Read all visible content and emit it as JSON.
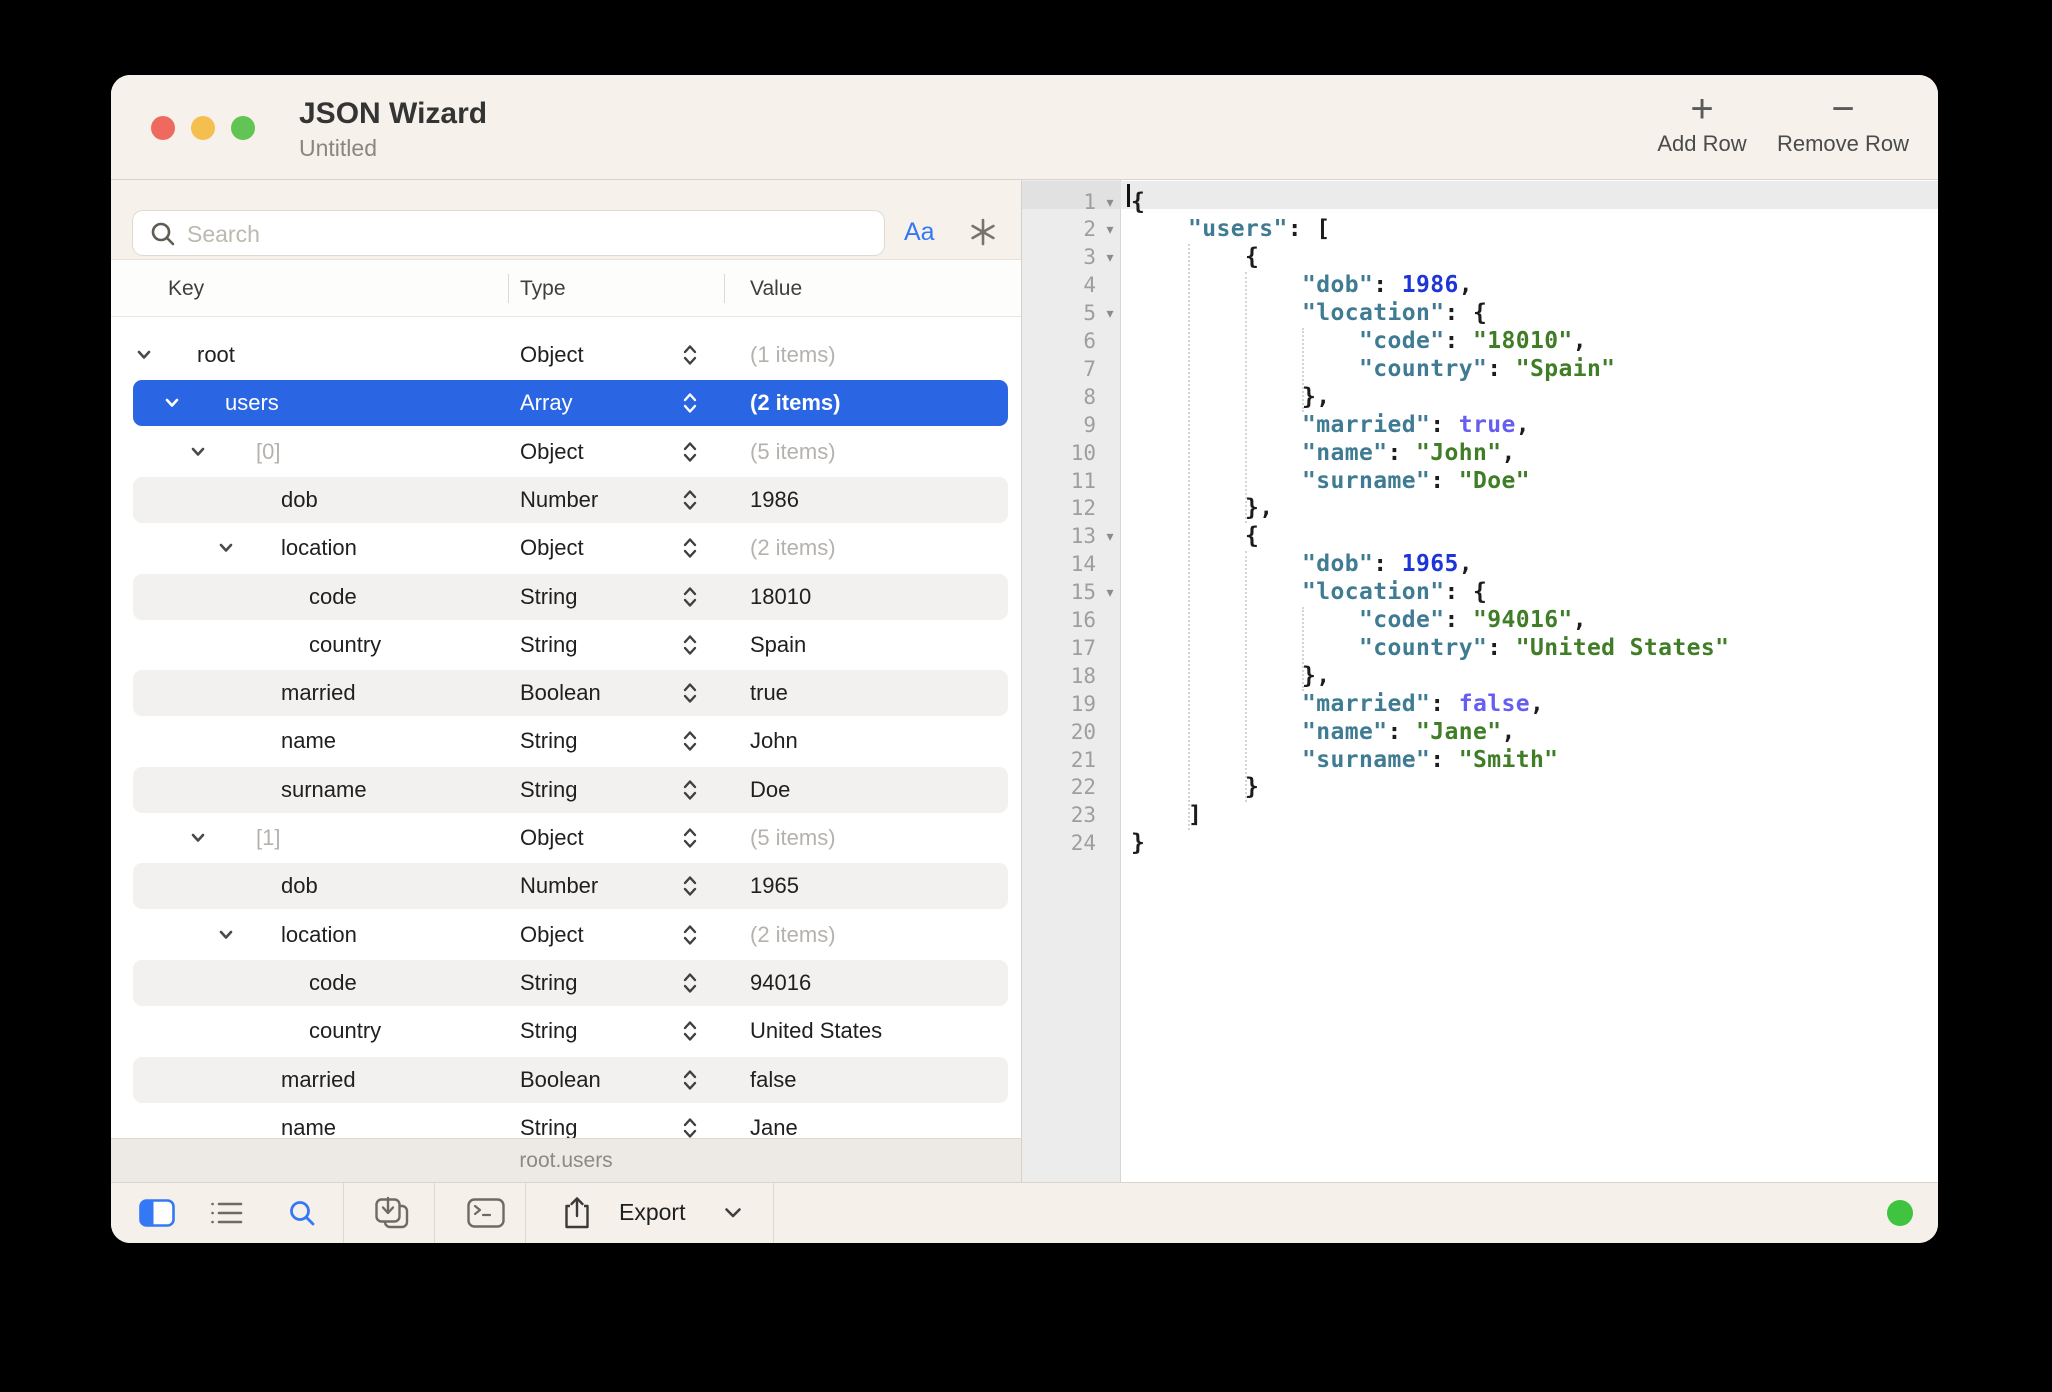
{
  "window": {
    "title": "JSON Wizard",
    "subtitle": "Untitled"
  },
  "actions": {
    "add_row": {
      "glyph": "+",
      "label": "Add Row"
    },
    "remove_row": {
      "glyph": "−",
      "label": "Remove Row"
    }
  },
  "search": {
    "placeholder": "Search",
    "match_case_label": "Aa"
  },
  "table": {
    "columns": [
      "Key",
      "Type",
      "Value"
    ],
    "rows": [
      {
        "key": "root",
        "level": 0,
        "expandable": true,
        "type": "Object",
        "value": "(1 items)",
        "muted_key": false,
        "muted_value": true,
        "selected": false,
        "shaded": false
      },
      {
        "key": "users",
        "level": 1,
        "expandable": true,
        "type": "Array",
        "value": "(2 items)",
        "muted_key": false,
        "muted_value": false,
        "selected": true,
        "shaded": false
      },
      {
        "key": "[0]",
        "level": 2,
        "expandable": true,
        "type": "Object",
        "value": "(5 items)",
        "muted_key": true,
        "muted_value": true,
        "selected": false,
        "shaded": false
      },
      {
        "key": "dob",
        "level": 3,
        "expandable": false,
        "type": "Number",
        "value": "1986",
        "muted_key": false,
        "muted_value": false,
        "selected": false,
        "shaded": true
      },
      {
        "key": "location",
        "level": 3,
        "expandable": true,
        "type": "Object",
        "value": "(2 items)",
        "muted_key": false,
        "muted_value": true,
        "selected": false,
        "shaded": false
      },
      {
        "key": "code",
        "level": 4,
        "expandable": false,
        "type": "String",
        "value": "18010",
        "muted_key": false,
        "muted_value": false,
        "selected": false,
        "shaded": true
      },
      {
        "key": "country",
        "level": 4,
        "expandable": false,
        "type": "String",
        "value": "Spain",
        "muted_key": false,
        "muted_value": false,
        "selected": false,
        "shaded": false
      },
      {
        "key": "married",
        "level": 3,
        "expandable": false,
        "type": "Boolean",
        "value": "true",
        "muted_key": false,
        "muted_value": false,
        "selected": false,
        "shaded": true
      },
      {
        "key": "name",
        "level": 3,
        "expandable": false,
        "type": "String",
        "value": "John",
        "muted_key": false,
        "muted_value": false,
        "selected": false,
        "shaded": false
      },
      {
        "key": "surname",
        "level": 3,
        "expandable": false,
        "type": "String",
        "value": "Doe",
        "muted_key": false,
        "muted_value": false,
        "selected": false,
        "shaded": true
      },
      {
        "key": "[1]",
        "level": 2,
        "expandable": true,
        "type": "Object",
        "value": "(5 items)",
        "muted_key": true,
        "muted_value": true,
        "selected": false,
        "shaded": false
      },
      {
        "key": "dob",
        "level": 3,
        "expandable": false,
        "type": "Number",
        "value": "1965",
        "muted_key": false,
        "muted_value": false,
        "selected": false,
        "shaded": true
      },
      {
        "key": "location",
        "level": 3,
        "expandable": true,
        "type": "Object",
        "value": "(2 items)",
        "muted_key": false,
        "muted_value": true,
        "selected": false,
        "shaded": false
      },
      {
        "key": "code",
        "level": 4,
        "expandable": false,
        "type": "String",
        "value": "94016",
        "muted_key": false,
        "muted_value": false,
        "selected": false,
        "shaded": true
      },
      {
        "key": "country",
        "level": 4,
        "expandable": false,
        "type": "String",
        "value": "United States",
        "muted_key": false,
        "muted_value": false,
        "selected": false,
        "shaded": false
      },
      {
        "key": "married",
        "level": 3,
        "expandable": false,
        "type": "Boolean",
        "value": "false",
        "muted_key": false,
        "muted_value": false,
        "selected": false,
        "shaded": true
      },
      {
        "key": "name",
        "level": 3,
        "expandable": false,
        "type": "String",
        "value": "Jane",
        "muted_key": false,
        "muted_value": false,
        "selected": false,
        "shaded": false
      }
    ]
  },
  "status_bar": {
    "path": "root.users"
  },
  "toolbar": {
    "export_label": "Export"
  },
  "editor": {
    "fold_glyph": "▾",
    "lines": [
      {
        "n": 1,
        "fold": true,
        "seg": [
          [
            "p",
            "{"
          ]
        ]
      },
      {
        "n": 2,
        "fold": true,
        "seg": [
          [
            "p",
            "    "
          ],
          [
            "k",
            "\"users\""
          ],
          [
            "p",
            ": ["
          ]
        ]
      },
      {
        "n": 3,
        "fold": true,
        "seg": [
          [
            "p",
            "        {"
          ]
        ]
      },
      {
        "n": 4,
        "fold": false,
        "seg": [
          [
            "p",
            "            "
          ],
          [
            "k",
            "\"dob\""
          ],
          [
            "p",
            ": "
          ],
          [
            "n",
            "1986"
          ],
          [
            "p",
            ","
          ]
        ]
      },
      {
        "n": 5,
        "fold": true,
        "seg": [
          [
            "p",
            "            "
          ],
          [
            "k",
            "\"location\""
          ],
          [
            "p",
            ": {"
          ]
        ]
      },
      {
        "n": 6,
        "fold": false,
        "seg": [
          [
            "p",
            "                "
          ],
          [
            "k",
            "\"code\""
          ],
          [
            "p",
            ": "
          ],
          [
            "s",
            "\"18010\""
          ],
          [
            "p",
            ","
          ]
        ]
      },
      {
        "n": 7,
        "fold": false,
        "seg": [
          [
            "p",
            "                "
          ],
          [
            "k",
            "\"country\""
          ],
          [
            "p",
            ": "
          ],
          [
            "s",
            "\"Spain\""
          ]
        ]
      },
      {
        "n": 8,
        "fold": false,
        "seg": [
          [
            "p",
            "            },"
          ]
        ]
      },
      {
        "n": 9,
        "fold": false,
        "seg": [
          [
            "p",
            "            "
          ],
          [
            "k",
            "\"married\""
          ],
          [
            "p",
            ": "
          ],
          [
            "b",
            "true"
          ],
          [
            "p",
            ","
          ]
        ]
      },
      {
        "n": 10,
        "fold": false,
        "seg": [
          [
            "p",
            "            "
          ],
          [
            "k",
            "\"name\""
          ],
          [
            "p",
            ": "
          ],
          [
            "s",
            "\"John\""
          ],
          [
            "p",
            ","
          ]
        ]
      },
      {
        "n": 11,
        "fold": false,
        "seg": [
          [
            "p",
            "            "
          ],
          [
            "k",
            "\"surname\""
          ],
          [
            "p",
            ": "
          ],
          [
            "s",
            "\"Doe\""
          ]
        ]
      },
      {
        "n": 12,
        "fold": false,
        "seg": [
          [
            "p",
            "        },"
          ]
        ]
      },
      {
        "n": 13,
        "fold": true,
        "seg": [
          [
            "p",
            "        {"
          ]
        ]
      },
      {
        "n": 14,
        "fold": false,
        "seg": [
          [
            "p",
            "            "
          ],
          [
            "k",
            "\"dob\""
          ],
          [
            "p",
            ": "
          ],
          [
            "n",
            "1965"
          ],
          [
            "p",
            ","
          ]
        ]
      },
      {
        "n": 15,
        "fold": true,
        "seg": [
          [
            "p",
            "            "
          ],
          [
            "k",
            "\"location\""
          ],
          [
            "p",
            ": {"
          ]
        ]
      },
      {
        "n": 16,
        "fold": false,
        "seg": [
          [
            "p",
            "                "
          ],
          [
            "k",
            "\"code\""
          ],
          [
            "p",
            ": "
          ],
          [
            "s",
            "\"94016\""
          ],
          [
            "p",
            ","
          ]
        ]
      },
      {
        "n": 17,
        "fold": false,
        "seg": [
          [
            "p",
            "                "
          ],
          [
            "k",
            "\"country\""
          ],
          [
            "p",
            ": "
          ],
          [
            "s",
            "\"United States\""
          ]
        ]
      },
      {
        "n": 18,
        "fold": false,
        "seg": [
          [
            "p",
            "            },"
          ]
        ]
      },
      {
        "n": 19,
        "fold": false,
        "seg": [
          [
            "p",
            "            "
          ],
          [
            "k",
            "\"married\""
          ],
          [
            "p",
            ": "
          ],
          [
            "b",
            "false"
          ],
          [
            "p",
            ","
          ]
        ]
      },
      {
        "n": 20,
        "fold": false,
        "seg": [
          [
            "p",
            "            "
          ],
          [
            "k",
            "\"name\""
          ],
          [
            "p",
            ": "
          ],
          [
            "s",
            "\"Jane\""
          ],
          [
            "p",
            ","
          ]
        ]
      },
      {
        "n": 21,
        "fold": false,
        "seg": [
          [
            "p",
            "            "
          ],
          [
            "k",
            "\"surname\""
          ],
          [
            "p",
            ": "
          ],
          [
            "s",
            "\"Smith\""
          ]
        ]
      },
      {
        "n": 22,
        "fold": false,
        "seg": [
          [
            "p",
            "        }"
          ]
        ]
      },
      {
        "n": 23,
        "fold": false,
        "seg": [
          [
            "p",
            "    ]"
          ]
        ]
      },
      {
        "n": 24,
        "fold": false,
        "seg": [
          [
            "p",
            "}"
          ]
        ]
      }
    ]
  },
  "colors": {
    "accent_blue": "#2a66e3",
    "link_blue": "#3478f6",
    "traffic_red": "#ee6a5f",
    "traffic_yellow": "#f5bf4f",
    "traffic_green": "#61c454",
    "status_green": "#40c33e",
    "code_key": "#3f7b93",
    "code_string": "#3f7d27",
    "code_number": "#1d34d8",
    "code_boolean": "#655ef0",
    "code_punct": "#1c1c1c"
  }
}
